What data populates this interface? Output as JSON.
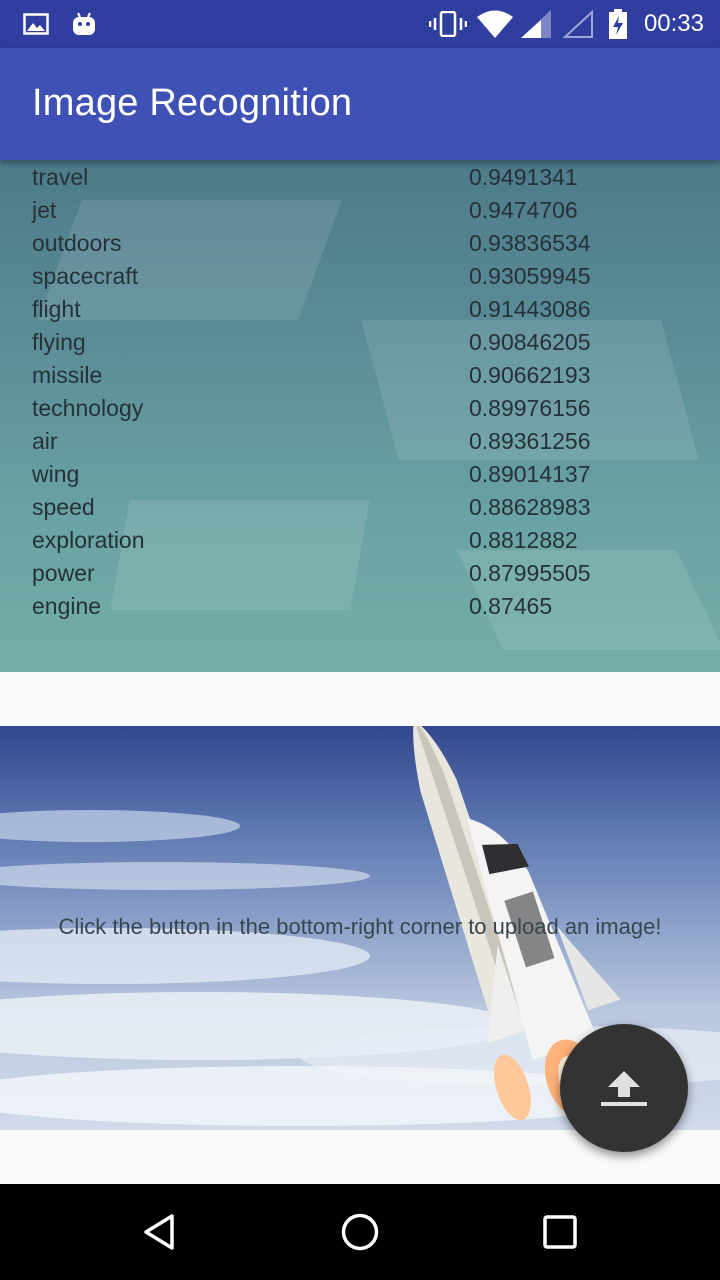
{
  "status_bar": {
    "time": "00:33",
    "icons": [
      "image-notification-icon",
      "android-notification-icon",
      "vibrate-icon",
      "wifi-icon",
      "cell-signal-icon",
      "cell-signal-empty-icon",
      "battery-charging-icon"
    ]
  },
  "app_bar": {
    "title": "Image Recognition"
  },
  "results": {
    "rows": [
      {
        "label": "travel",
        "value": "0.9491341"
      },
      {
        "label": "jet",
        "value": "0.9474706"
      },
      {
        "label": "outdoors",
        "value": "0.93836534"
      },
      {
        "label": "spacecraft",
        "value": "0.93059945"
      },
      {
        "label": "flight",
        "value": "0.91443086"
      },
      {
        "label": "flying",
        "value": "0.90846205"
      },
      {
        "label": "missile",
        "value": "0.90662193"
      },
      {
        "label": "technology",
        "value": "0.89976156"
      },
      {
        "label": "air",
        "value": "0.89361256"
      },
      {
        "label": "wing",
        "value": "0.89014137"
      },
      {
        "label": "speed",
        "value": "0.88628983"
      },
      {
        "label": "exploration",
        "value": "0.8812882"
      },
      {
        "label": "power",
        "value": "0.87995505"
      },
      {
        "label": "engine",
        "value": "0.87465"
      }
    ]
  },
  "image_panel": {
    "hint": "Click the button in the bottom-right corner to upload an image!"
  },
  "fab": {
    "icon": "upload-icon"
  },
  "nav_bar": {
    "icons": [
      "back-icon",
      "home-icon",
      "recents-icon"
    ]
  }
}
